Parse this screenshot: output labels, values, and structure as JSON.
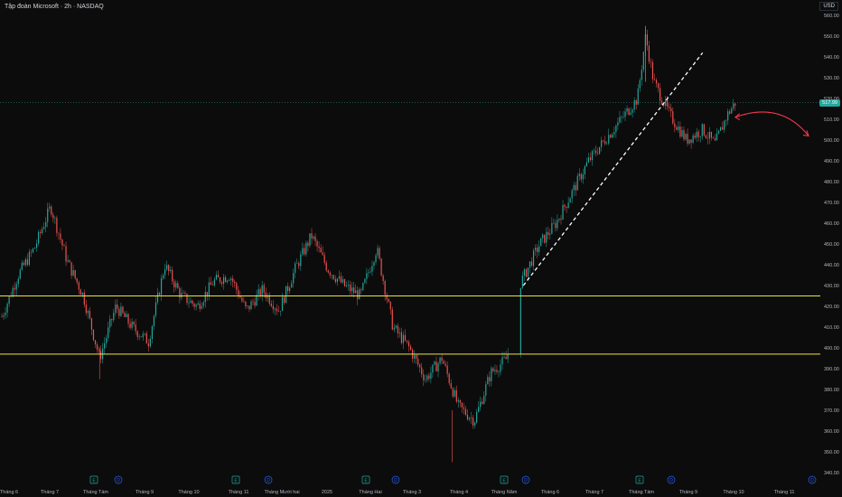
{
  "header": {
    "title": "Tập đoàn Microsoft · 2h · NASDAQ",
    "currency": "USD"
  },
  "price_tag": "517.99",
  "colors": {
    "up": "#26a69a",
    "down": "#ef5350",
    "support": "#f0e040",
    "trend": "#ffffff",
    "arrow": "#f2364d",
    "event_earnings": "#26a69a",
    "event_dividend": "#2962ff"
  },
  "event_markers": [
    {
      "type": "earnings",
      "label": "E",
      "icon": "earnings-icon"
    },
    {
      "type": "dividend",
      "label": "D",
      "icon": "dividend-icon"
    }
  ],
  "chart_data": {
    "type": "candlestick",
    "title": "Tập đoàn Microsoft · 2h · NASDAQ",
    "ylim": [
      340,
      560
    ],
    "y_ticks": [
      340,
      350,
      360,
      370,
      380,
      390,
      400,
      410,
      420,
      430,
      440,
      450,
      460,
      470,
      480,
      490,
      500,
      510,
      520,
      530,
      540,
      550,
      560
    ],
    "x_tick_labels": [
      "Tháng 6",
      "Tháng 7",
      "Tháng Tám",
      "Tháng 9",
      "Tháng 10",
      "Tháng 11",
      "Tháng Mười hai",
      "2025",
      "Tháng Hai",
      "Tháng 3",
      "Tháng 4",
      "Tháng Năm",
      "Tháng 6",
      "Tháng 7",
      "Tháng Tám",
      "Tháng 9",
      "Tháng 10",
      "Tháng 11"
    ],
    "path": [
      {
        "t": 0,
        "p": 415
      },
      {
        "t": 4,
        "p": 435
      },
      {
        "t": 8,
        "p": 448
      },
      {
        "t": 12,
        "p": 468
      },
      {
        "t": 16,
        "p": 442
      },
      {
        "t": 20,
        "p": 425
      },
      {
        "t": 24,
        "p": 395
      },
      {
        "t": 28,
        "p": 420
      },
      {
        "t": 32,
        "p": 410
      },
      {
        "t": 36,
        "p": 403
      },
      {
        "t": 40,
        "p": 440
      },
      {
        "t": 44,
        "p": 425
      },
      {
        "t": 48,
        "p": 420
      },
      {
        "t": 52,
        "p": 432
      },
      {
        "t": 56,
        "p": 435
      },
      {
        "t": 60,
        "p": 418
      },
      {
        "t": 64,
        "p": 428
      },
      {
        "t": 68,
        "p": 418
      },
      {
        "t": 72,
        "p": 438
      },
      {
        "t": 76,
        "p": 454
      },
      {
        "t": 80,
        "p": 438
      },
      {
        "t": 84,
        "p": 430
      },
      {
        "t": 88,
        "p": 425
      },
      {
        "t": 92,
        "p": 448
      },
      {
        "t": 96,
        "p": 410
      },
      {
        "t": 100,
        "p": 400
      },
      {
        "t": 104,
        "p": 385
      },
      {
        "t": 108,
        "p": 395
      },
      {
        "t": 112,
        "p": 372
      },
      {
        "t": 116,
        "p": 365
      },
      {
        "t": 120,
        "p": 388
      },
      {
        "t": 124,
        "p": 395
      },
      {
        "t": 127,
        "p": 430
      },
      {
        "t": 132,
        "p": 450
      },
      {
        "t": 136,
        "p": 460
      },
      {
        "t": 140,
        "p": 475
      },
      {
        "t": 144,
        "p": 490
      },
      {
        "t": 148,
        "p": 500
      },
      {
        "t": 152,
        "p": 510
      },
      {
        "t": 156,
        "p": 520
      },
      {
        "t": 158,
        "p": 550
      },
      {
        "t": 160,
        "p": 528
      },
      {
        "t": 164,
        "p": 512
      },
      {
        "t": 168,
        "p": 500
      },
      {
        "t": 172,
        "p": 505
      },
      {
        "t": 175,
        "p": 498
      },
      {
        "t": 178,
        "p": 512
      },
      {
        "t": 180,
        "p": 517.99
      }
    ],
    "last_price": 517.99,
    "support_lines": [
      425,
      397
    ],
    "trendline": {
      "from": {
        "t": 128,
        "p": 430
      },
      "to": {
        "t": 172,
        "p": 542
      }
    },
    "projection_arrow": {
      "from": {
        "t": 180,
        "p": 511
      },
      "to": {
        "t": 198,
        "p": 502
      }
    }
  }
}
